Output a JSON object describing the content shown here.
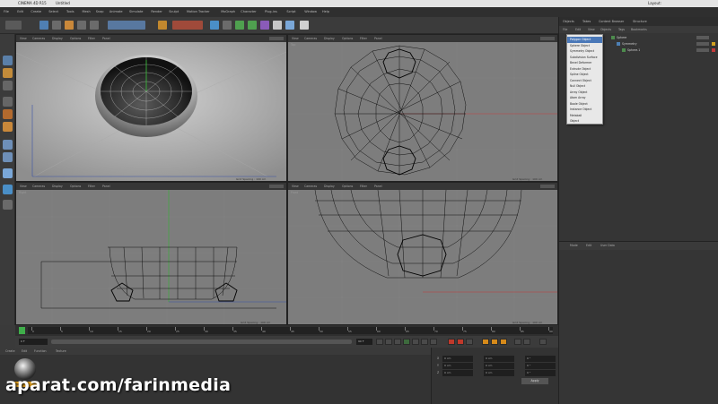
{
  "app": {
    "title": "CINEMA 4D R15",
    "doc_title": "Untitled",
    "layout_label": "Layout:",
    "layout_value": "Startup"
  },
  "menubar": [
    "File",
    "Edit",
    "Create",
    "Select",
    "Tools",
    "Mesh",
    "Snap",
    "Animate",
    "Simulate",
    "Render",
    "Sculpt",
    "Motion Tracker",
    "MoGraph",
    "Character",
    "Plug-ins",
    "Script",
    "Window",
    "Help"
  ],
  "viewports": [
    {
      "id": "perspective",
      "name": "Perspective",
      "menu": [
        "View",
        "Cameras",
        "Display",
        "Options",
        "Filter",
        "Panel"
      ],
      "grid": "Grid Spacing : 100 cm"
    },
    {
      "id": "top",
      "name": "Top",
      "menu": [
        "View",
        "Cameras",
        "Display",
        "Options",
        "Filter",
        "Panel"
      ],
      "grid": "Grid Spacing : 100 cm"
    },
    {
      "id": "right",
      "name": "Right",
      "menu": [
        "View",
        "Cameras",
        "Display",
        "Options",
        "Filter",
        "Panel"
      ],
      "grid": "Grid Spacing : 100 cm"
    },
    {
      "id": "front",
      "name": "Front",
      "menu": [
        "View",
        "Cameras",
        "Display",
        "Options",
        "Filter",
        "Panel"
      ],
      "grid": "Grid Spacing : 100 cm"
    }
  ],
  "timeline": {
    "ticks": [
      "0",
      "5",
      "10",
      "15",
      "20",
      "25",
      "30",
      "35",
      "40",
      "45",
      "50",
      "55",
      "60",
      "65",
      "70",
      "75",
      "80",
      "85",
      "90"
    ],
    "current_frame": "0 F",
    "start_frame": "0 F",
    "end_frame": "90 F"
  },
  "material_panel": {
    "menu": [
      "Create",
      "Edit",
      "Function",
      "Texture"
    ],
    "material_name": "Mat"
  },
  "coordinates": {
    "labels": [
      "X",
      "Y",
      "Z"
    ],
    "position": [
      "0 cm",
      "0 cm",
      "0 cm"
    ],
    "size": [
      "0 cm",
      "0 cm",
      "0 cm"
    ],
    "rotation": [
      "0 °",
      "0 °",
      "0 °"
    ],
    "apply_label": "Apply"
  },
  "right_panel": {
    "tabs": [
      "Objects",
      "Takes",
      "Content Browser",
      "Structure"
    ],
    "menu": [
      "File",
      "Edit",
      "View",
      "Objects",
      "Tags",
      "Bookmarks"
    ],
    "objects": [
      {
        "name": "Sphere"
      },
      {
        "name": "Symmetry"
      },
      {
        "name": "Sphere.1"
      }
    ],
    "dropdown": [
      "Polygon Object",
      "Sphere Object",
      "Symmetry Object",
      "Subdivision Surface",
      "Bevel Deformer",
      "Extrude Object",
      "Spline Object",
      "Connect Object",
      "Null Object",
      "Array Object",
      "Atom Array",
      "Boole Object",
      "Instance Object",
      "Metaball",
      "Object"
    ],
    "attributes_tabs": [
      "Mode",
      "Edit",
      "User Data"
    ]
  },
  "watermark": "aparat.com/farinmedia"
}
